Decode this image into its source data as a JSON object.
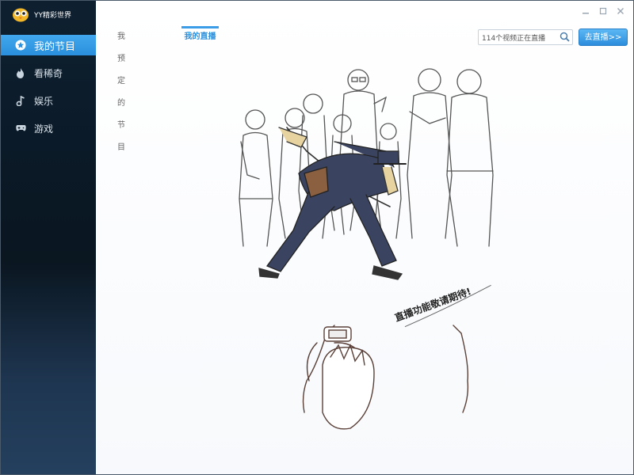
{
  "app": {
    "title": "YY精彩世界"
  },
  "sidebar": {
    "items": [
      {
        "label": "我的节目",
        "icon": "star-icon",
        "active": true
      },
      {
        "label": "看稀奇",
        "icon": "flame-icon",
        "active": false
      },
      {
        "label": "娱乐",
        "icon": "music-note-icon",
        "active": false
      },
      {
        "label": "游戏",
        "icon": "gamepad-icon",
        "active": false
      }
    ]
  },
  "tabs": [
    {
      "label": "我预定的节目",
      "active": false
    },
    {
      "label": "我的直播",
      "active": true
    }
  ],
  "search": {
    "value": "114个视频正在直播"
  },
  "go_live_button": {
    "label": "去直播>>"
  },
  "illustration": {
    "caption": "直播功能敬请期待!"
  },
  "colors": {
    "accent": "#3b9ce8",
    "sidebar_bg": "#0b1a28"
  }
}
